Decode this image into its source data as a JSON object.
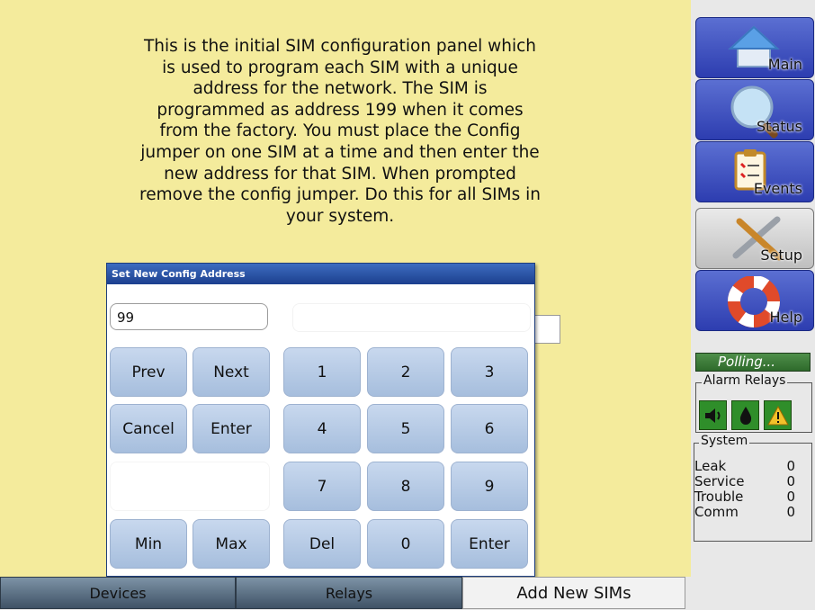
{
  "description_lines": [
    "This is the initial SIM configuration panel which",
    "is used to program each SIM with a unique",
    "address for the network. The SIM is",
    "programmed as address 199 when it comes",
    "from the factory. You must place the Config",
    "jumper on one SIM at a time and then enter the",
    "new address for that SIM. When prompted",
    "remove the config jumper. Do this for all SIMs in",
    "your system."
  ],
  "keypad": {
    "title": "Set New Config Address",
    "input_value": "99",
    "keys": {
      "prev": "Prev",
      "next": "Next",
      "cancel": "Cancel",
      "enter_left": "Enter",
      "min": "Min",
      "max": "Max",
      "del": "Del",
      "enter_right": "Enter",
      "k1": "1",
      "k2": "2",
      "k3": "3",
      "k4": "4",
      "k5": "5",
      "k6": "6",
      "k7": "7",
      "k8": "8",
      "k9": "9",
      "k0": "0"
    }
  },
  "tabs": {
    "devices": "Devices",
    "relays": "Relays",
    "add_new_sims": "Add New SIMs"
  },
  "nav": {
    "main": "Main",
    "status": "Status",
    "events": "Events",
    "setup": "Setup",
    "help": "Help"
  },
  "polling": "Polling...",
  "alarm_relays": {
    "label": "Alarm Relays",
    "icons": [
      "speaker-icon",
      "water-drop-icon",
      "warning-icon"
    ]
  },
  "system": {
    "label": "System",
    "rows": [
      {
        "name": "Leak",
        "value": "0"
      },
      {
        "name": "Service",
        "value": "0"
      },
      {
        "name": "Trouble",
        "value": "0"
      },
      {
        "name": "Comm",
        "value": "0"
      }
    ]
  },
  "colors": {
    "background": "#f4eb9c",
    "key": "#b7cbe6",
    "nav": "#3b4cc0",
    "title_bar": "#2a50a4",
    "relay": "#2f8e2a"
  }
}
